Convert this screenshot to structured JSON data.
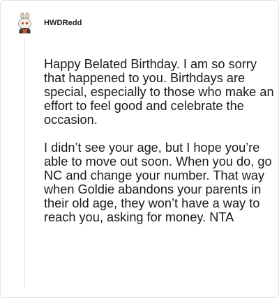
{
  "comment": {
    "author": "HWDRedd",
    "avatar_icon": "snoo-avatar-icon",
    "paragraphs": [
      "Happy Belated Birthday. I am so sorry that happened to you. Birthdays are special, especially to those who make an effort to feel good and celebrate the occasion.",
      "I didn’t see your age, but I hope you’re able to move out soon. When you do, go NC and change your number. That way when Goldie abandons your parents in their old age, they won’t have a way to reach you, asking for money. NTA"
    ]
  }
}
